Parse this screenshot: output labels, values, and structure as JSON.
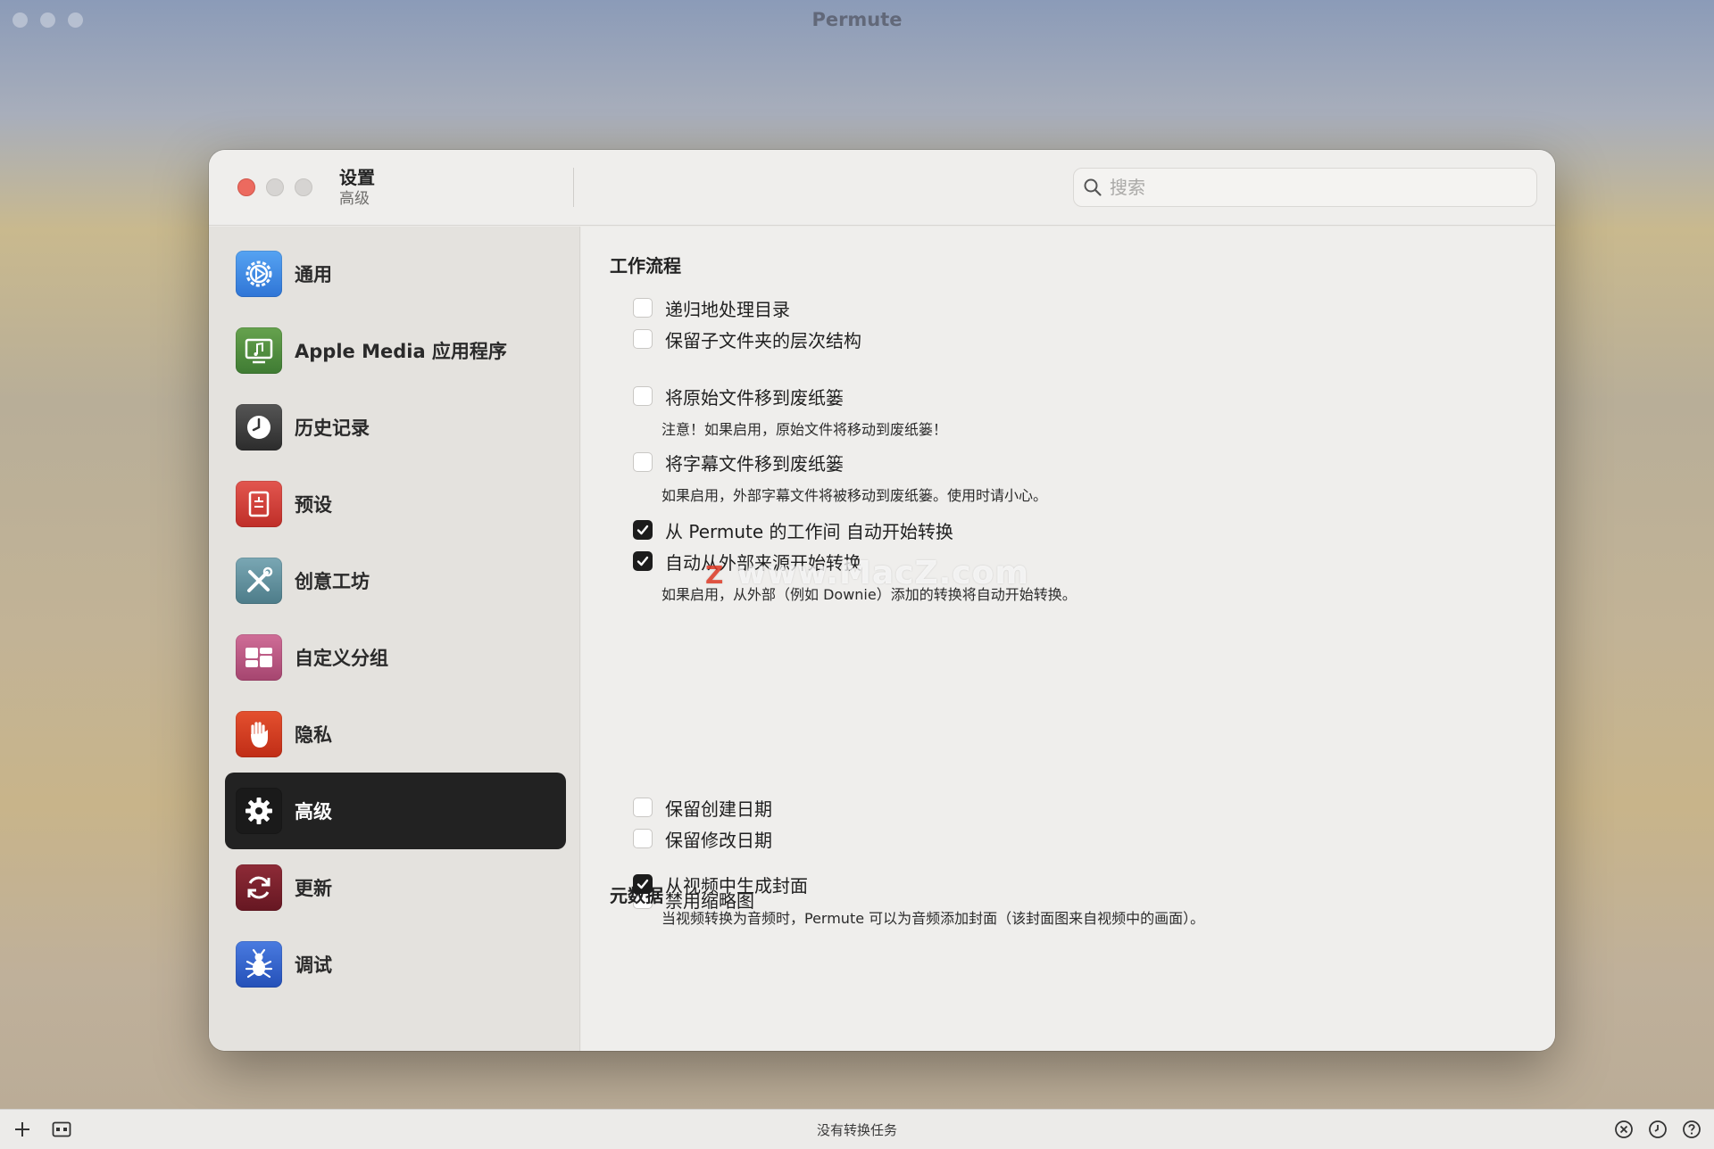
{
  "app": {
    "title": "Permute"
  },
  "dialog": {
    "title": "设置",
    "subtitle": "高级"
  },
  "search": {
    "placeholder": "搜索"
  },
  "sidebar": {
    "items": [
      {
        "label": "通用",
        "icon": "gear-dial-icon",
        "color": "#3b86e0"
      },
      {
        "label": "Apple Media 应用程序",
        "icon": "music-display-icon",
        "color": "#4c8a3e"
      },
      {
        "label": "历史记录",
        "icon": "clock-icon",
        "color": "#3a3a3a"
      },
      {
        "label": "预设",
        "icon": "preset-sliders-icon",
        "color": "#d23b34"
      },
      {
        "label": "创意工坊",
        "icon": "tools-icon",
        "color": "#5e8c9a"
      },
      {
        "label": "自定义分组",
        "icon": "group-blocks-icon",
        "color": "#b6557f"
      },
      {
        "label": "隐私",
        "icon": "hand-icon",
        "color": "#d33a25"
      },
      {
        "label": "高级",
        "icon": "gear-icon",
        "color": "#1a1a1a",
        "active": true
      },
      {
        "label": "更新",
        "icon": "refresh-icon",
        "color": "#7a1f2b"
      },
      {
        "label": "调试",
        "icon": "bug-icon",
        "color": "#2f5fc9"
      }
    ]
  },
  "sections": {
    "workflow": {
      "title": "工作流程",
      "options": [
        {
          "label": "递归地处理目录",
          "checked": false
        },
        {
          "label": "保留子文件夹的层次结构",
          "checked": false
        },
        {
          "label": "将原始文件移到废纸篓",
          "checked": false
        },
        {
          "label": "将字幕文件移到废纸篓",
          "checked": false
        },
        {
          "label": "从 Permute 的工作间 自动开始转换",
          "checked": true
        },
        {
          "label": "自动从外部来源开始转换",
          "checked": true
        },
        {
          "label": "禁用缩略图",
          "checked": false
        }
      ],
      "notes": [
        "注意！如果启用，原始文件将移动到废纸篓！",
        "如果启用，外部字幕文件将被移动到废纸篓。使用时请小心。",
        "如果启用，从外部（例如 Downie）添加的转换将自动开始转换。"
      ]
    },
    "metadata": {
      "title": "元数据",
      "options": [
        {
          "label": "保留创建日期",
          "checked": false
        },
        {
          "label": "保留修改日期",
          "checked": false
        },
        {
          "label": "从视频中生成封面",
          "checked": true
        }
      ],
      "notes": [
        "当视频转换为音频时，Permute 可以为音频添加封面（该封面图来自视频中的画面）。"
      ]
    }
  },
  "watermark": {
    "text": "www.MacZ.com",
    "mark": "Z"
  },
  "status": {
    "text": "没有转换任务"
  }
}
